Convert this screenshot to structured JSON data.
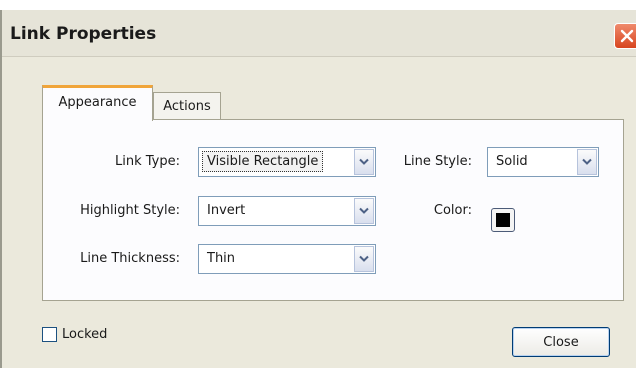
{
  "window": {
    "title": "Link Properties"
  },
  "tabs": [
    {
      "label": "Appearance",
      "active": true
    },
    {
      "label": "Actions",
      "active": false
    }
  ],
  "fields": {
    "link_type": {
      "label": "Link Type:",
      "value": "Visible Rectangle"
    },
    "line_style": {
      "label": "Line Style:",
      "value": "Solid"
    },
    "highlight_style": {
      "label": "Highlight Style:",
      "value": "Invert"
    },
    "color": {
      "label": "Color:",
      "value": "#000000"
    },
    "line_thickness": {
      "label": "Line Thickness:",
      "value": "Thin"
    }
  },
  "footer": {
    "locked_label": "Locked",
    "locked_checked": false,
    "close_label": "Close"
  },
  "icons": {
    "window_close": "close-icon",
    "dropdown": "chevron-down-icon"
  },
  "colors": {
    "tab_accent": "#f0a53a",
    "close_button_red": "#d8451f"
  }
}
